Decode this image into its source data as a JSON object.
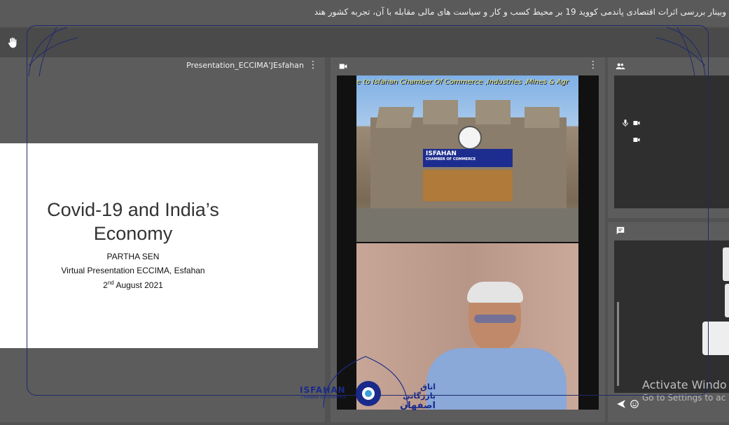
{
  "meeting": {
    "title": "وبینار بررسی اثرات اقتصادی پاندمی کووید 19 بر محیط کسب و کار و سیاست های مالی مقابله با آن، تجربه کشور هند"
  },
  "presentation": {
    "name": "Presentation_ECCIMAʼJEsfahan",
    "slide": {
      "heading_line1": "Covid-19 and India’s",
      "heading_line2": "Economy",
      "presenter": "PARTHA SEN",
      "event": "Virtual Presentation ECCIMA, Esfahan",
      "date_day": "2",
      "date_suffix": "nd",
      "date_rest": " August 2021"
    }
  },
  "video": {
    "marquee": "e to Isfahan Chamber Of Commerce ,Industries ,Mines & Agr",
    "sign_en": "ISFAHAN",
    "sign_sub": "CHAMBER OF COMMERCE"
  },
  "logo": {
    "en": "ISFAHAN",
    "sub": "CHAMBER OF COMMERCE",
    "fa_line1": "اتاق بازرگانی",
    "fa_line2": "اصفهان"
  },
  "watermark": {
    "line1": "Activate Windo",
    "line2": "Go to Settings to ac"
  },
  "colors": {
    "background": "#525252",
    "panel": "#5c5c5c",
    "brand": "#1a2a8a"
  },
  "icons": [
    "raise-hand-icon",
    "more-options-icon",
    "camera-icon",
    "participants-icon",
    "microphone-icon",
    "chat-icon",
    "send-icon",
    "emoji-icon"
  ]
}
